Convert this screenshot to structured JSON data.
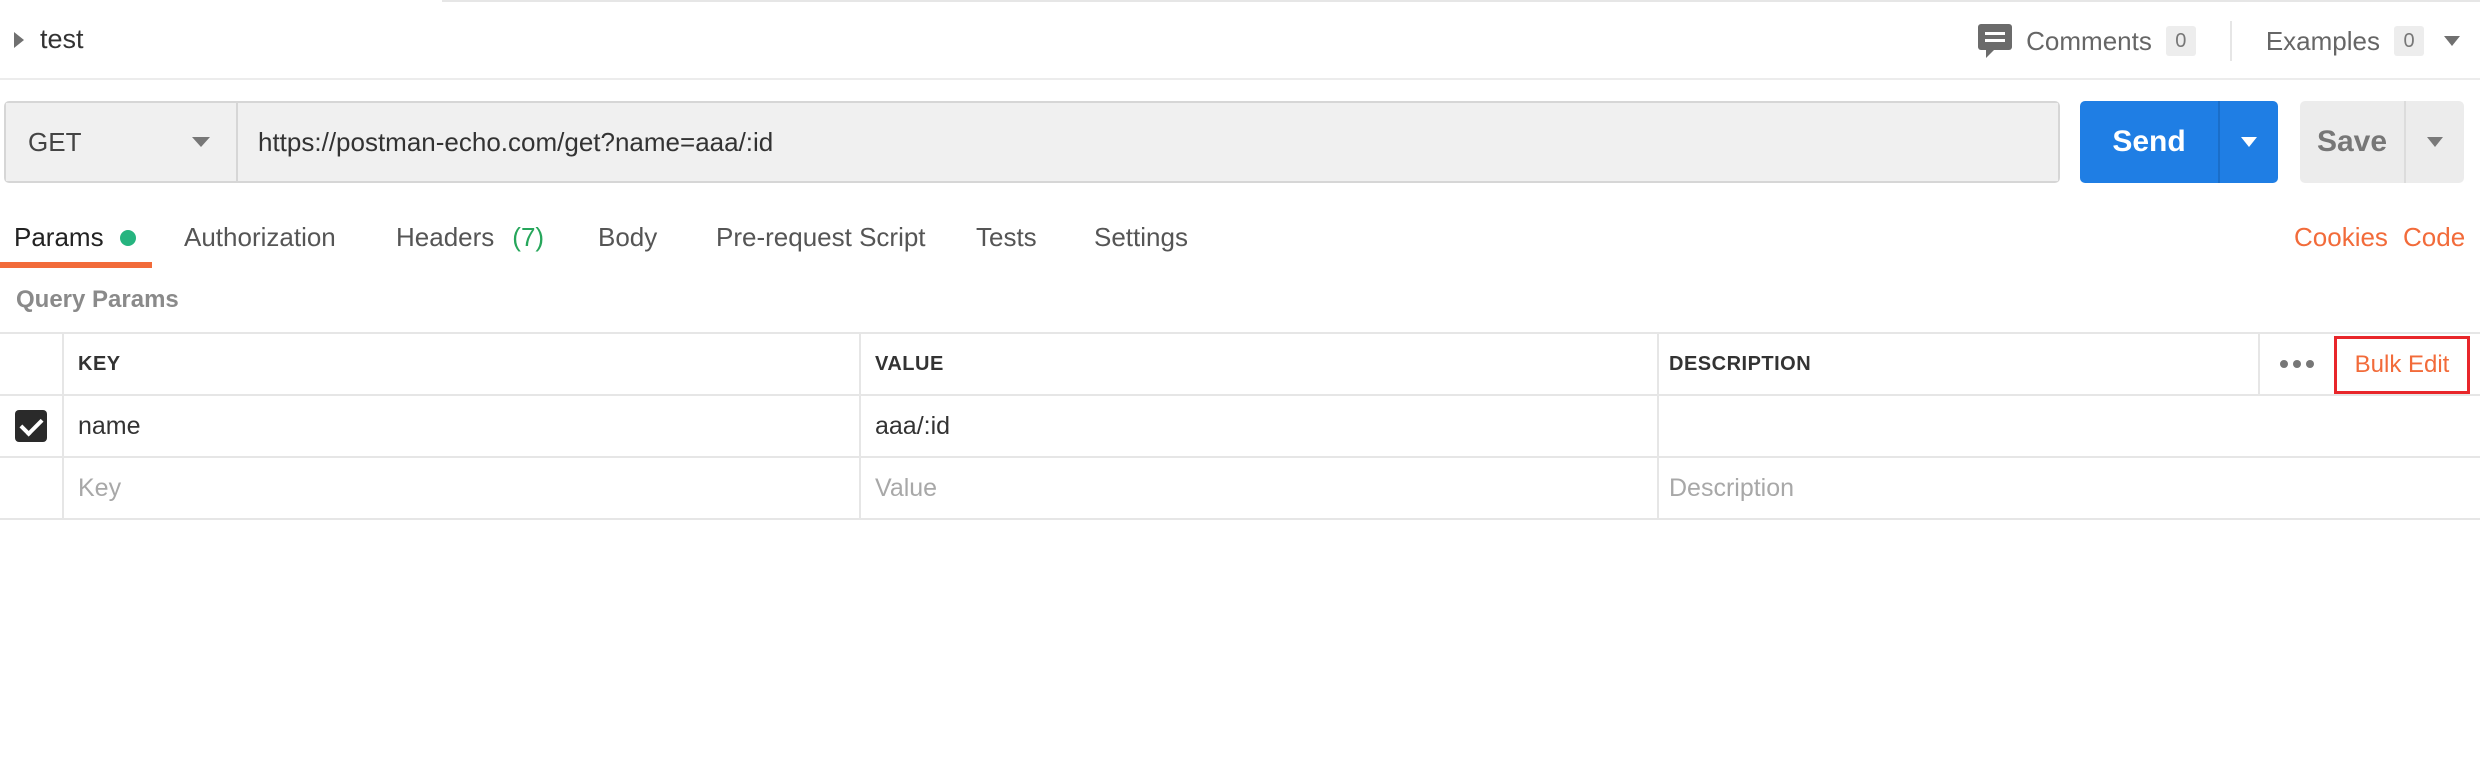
{
  "header": {
    "title": "test",
    "comments_label": "Comments",
    "comments_count": "0",
    "examples_label": "Examples",
    "examples_count": "0"
  },
  "request": {
    "method": "GET",
    "url": "https://postman-echo.com/get?name=aaa/:id",
    "send_label": "Send",
    "save_label": "Save"
  },
  "tabs": [
    {
      "label": "Params",
      "active": true,
      "status": "green-dot"
    },
    {
      "label": "Authorization"
    },
    {
      "label": "Headers",
      "count": "(7)"
    },
    {
      "label": "Body"
    },
    {
      "label": "Pre-request Script"
    },
    {
      "label": "Tests"
    },
    {
      "label": "Settings"
    }
  ],
  "links": {
    "cookies": "Cookies",
    "code": "Code"
  },
  "query_params": {
    "title": "Query Params",
    "columns": {
      "key": "KEY",
      "value": "VALUE",
      "description": "DESCRIPTION"
    },
    "bulk_edit_label": "Bulk Edit",
    "rows": [
      {
        "checked": true,
        "key": "name",
        "value": "aaa/:id",
        "description": ""
      }
    ],
    "placeholders": {
      "key": "Key",
      "value": "Value",
      "description": "Description"
    }
  },
  "colors": {
    "accent": "#f26b3a",
    "send": "#1f7ee4",
    "status_green": "#26b47f",
    "highlight_border": "#e8262a"
  }
}
